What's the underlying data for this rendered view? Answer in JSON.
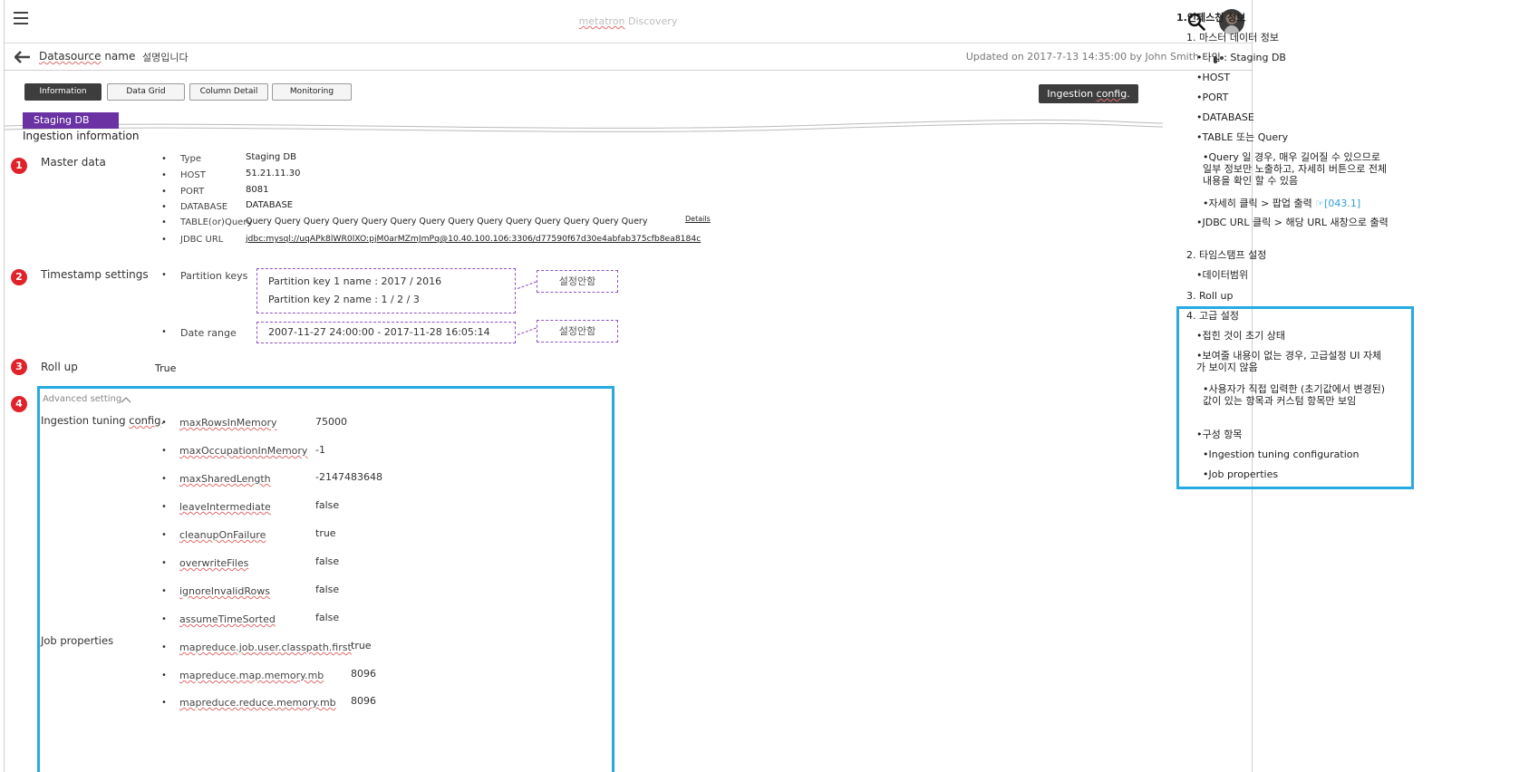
{
  "header": {
    "app_brand": "metatron",
    "app_suffix": " Discovery",
    "hamburger_label": "menu",
    "search_label": "search",
    "avatar_label": "user"
  },
  "subheader": {
    "datasource_word": "Datasource",
    "datasource_rest": " name",
    "description": "설명입니다",
    "updated": "Updated on 2017-7-13 14:35:00 by John Smith"
  },
  "tabs": [
    {
      "label": "Information",
      "active": true
    },
    {
      "label": "Data Grid",
      "active": false
    },
    {
      "label": "Column Detail",
      "active": false
    },
    {
      "label": "Monitoring",
      "active": false
    }
  ],
  "ingestion_button": {
    "pre": "Ingestion ",
    "wavy": "config",
    "post": "."
  },
  "stage_tag": "Staging DB",
  "section_title": "Ingestion information",
  "badges": [
    "1",
    "2",
    "3",
    "4"
  ],
  "master": {
    "label": "Master data",
    "bullet": "•",
    "rows": [
      {
        "key": "Type",
        "value": "Staging DB"
      },
      {
        "key": "HOST",
        "value": "51.21.11.30"
      },
      {
        "key": "PORT",
        "value": "8081"
      },
      {
        "key": "DATABASE",
        "value": "DATABASE"
      },
      {
        "key": "TABLE(or)Query",
        "value": "Query Query Query Query Query Query Query Query Query Query Query Query Query Query"
      },
      {
        "key": "JDBC URL",
        "value": "jdbc:mysql://uqAPk8lWR0lXO:pjM0arMZmJmPq@10.40.100.106:3306/d77590f67d30e4abfab375cfb8ea8184c"
      }
    ],
    "details_link": "Details"
  },
  "timestamp": {
    "label": "Timestamp settings",
    "partition_keys_label": "Partition keys",
    "partition_key_1": "Partition key 1 name : 2017 / 2016",
    "partition_key_2": "Partition key 2 name : 1 / 2 / 3",
    "tag_1": "설정안함",
    "date_range_label": "Date range",
    "date_range_value": "2007-11-27 24:00:00  -  2017-11-28 16:05:14",
    "tag_2": "설정안함"
  },
  "rollup": {
    "label": "Roll up",
    "value": "True"
  },
  "advanced": {
    "title": "Advanced setting",
    "tuning_label_pre": "Ingestion tuning ",
    "tuning_label_wavy": "config",
    "tuning_label_post": ".",
    "tuning": [
      {
        "key": "maxRowsInMemory",
        "value": "75000"
      },
      {
        "key": "maxOccupationInMemory",
        "value": "-1"
      },
      {
        "key": "maxSharedLength",
        "value": "-2147483648"
      },
      {
        "key": "leaveIntermediate",
        "value": "false"
      },
      {
        "key": "cleanupOnFailure",
        "value": "true"
      },
      {
        "key": "overwriteFiles",
        "value": "false"
      },
      {
        "key": "ignoreInvalidRows",
        "value": "false"
      },
      {
        "key": "assumeTimeSorted",
        "value": "false"
      }
    ],
    "job_label": "Job properties",
    "job": [
      {
        "key": "mapreduce.job.user.classpath.first",
        "value": "true"
      },
      {
        "key": "mapreduce.map.memory.mb",
        "value": "8096"
      },
      {
        "key": "mapreduce.reduce.memory.mb",
        "value": "8096"
      }
    ]
  },
  "notes": {
    "heading": "1.인제스천 정보",
    "s1": "1. 마스터 데이터 정보",
    "s1_items": [
      "•타입 : Staging DB",
      "•HOST",
      "•PORT",
      "•DATABASE",
      "•TABLE 또는 Query"
    ],
    "s1_query_note": "•Query 일 경우, 매우 길어질 수 있으므로 일부 정보만 노출하고, 자세히 버튼으로 전체 내용을 확인 할 수 있음",
    "s1_detail_note": "•자세히 클릭 > 팝업 출력 ",
    "s1_detail_link": "☞[043.1]",
    "s1_jdbc_note": "•JDBC URL 클릭 > 해당 URL 새창으로 출력",
    "s2": "2. 타임스탬프 설정",
    "s2_item": "•데이터범위",
    "s3": "3. Roll up",
    "s4": "4. 고급 설정",
    "s4_items": [
      "•접힌 것이 초기 상태",
      "•보여줄 내용이 없는 경우, 고급설정 UI 자체가 보이지 않음",
      "•사용자가 직접 입력한 (초기값에서 변경된) 값이 있는 항목과 커스텀 항목만 보임",
      "•구성 항목",
      "•Ingestion tuning configuration",
      "•Job properties"
    ]
  }
}
